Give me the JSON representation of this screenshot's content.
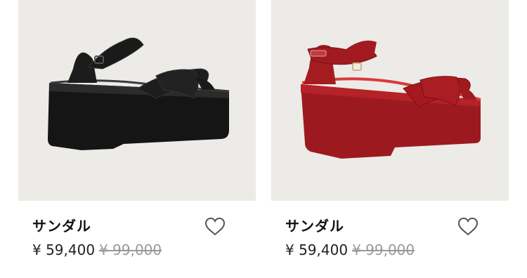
{
  "products": [
    {
      "name": "サンダル",
      "sale_price": "¥ 59,400",
      "original_price": "¥ 99,000",
      "image": "black-platform-sandal",
      "color": "#151515",
      "accent": "#2b2b2b",
      "wishlist_icon": "heart-outline-icon"
    },
    {
      "name": "サンダル",
      "sale_price": "¥ 59,400",
      "original_price": "¥ 99,000",
      "image": "red-suede-platform-sandal",
      "color": "#9c1a1f",
      "accent": "#c0282c",
      "wishlist_icon": "heart-outline-icon"
    }
  ]
}
